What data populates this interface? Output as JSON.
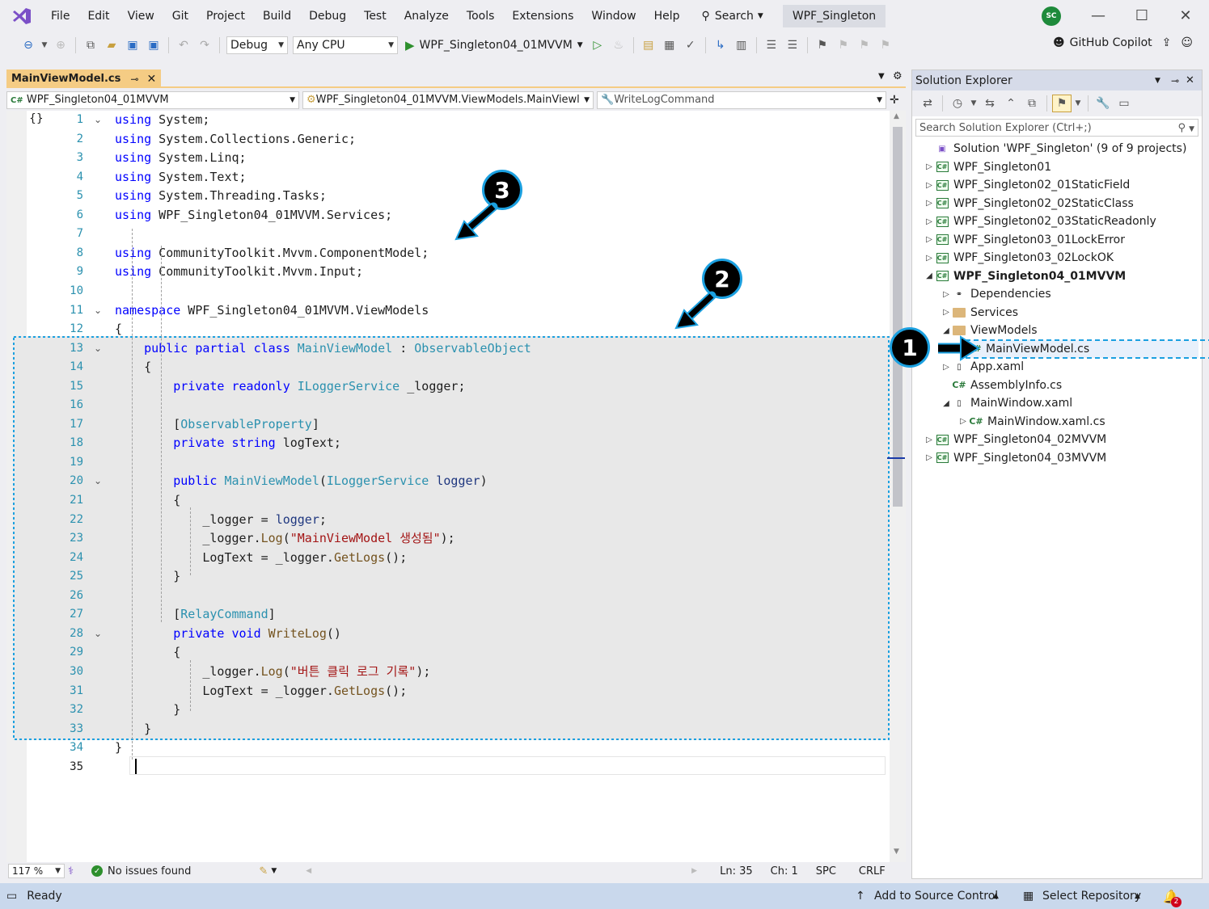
{
  "menu": [
    "File",
    "Edit",
    "View",
    "Git",
    "Project",
    "Build",
    "Debug",
    "Test",
    "Analyze",
    "Tools",
    "Extensions",
    "Window",
    "Help"
  ],
  "search_label": "Search",
  "solution_title": "WPF_Singleton",
  "avatar_initials": "SC",
  "toolbar": {
    "config": "Debug",
    "platform": "Any CPU",
    "run_target": "WPF_Singleton04_01MVVM",
    "copilot": "GitHub Copilot"
  },
  "editor": {
    "tab": "MainViewModel.cs",
    "nav_project": "WPF_Singleton04_01MVVM",
    "nav_class": "WPF_Singleton04_01MVVM.ViewModels.MainViewl",
    "nav_member": "WriteLogCommand",
    "zoom": "117 %",
    "issues": "No issues found",
    "ln": "Ln: 35",
    "ch": "Ch: 1",
    "spc": "SPC",
    "crlf": "CRLF"
  },
  "code_lines": [
    "1",
    "2",
    "3",
    "4",
    "5",
    "6",
    "7",
    "8",
    "9",
    "10",
    "11",
    "12",
    "13",
    "14",
    "15",
    "16",
    "17",
    "18",
    "19",
    "20",
    "21",
    "22",
    "23",
    "24",
    "25",
    "26",
    "27",
    "28",
    "29",
    "30",
    "31",
    "32",
    "33",
    "34",
    "35"
  ],
  "code_text": {
    "l1": "System;",
    "l2": "System.Collections.Generic;",
    "l3": "System.Linq;",
    "l4": "System.Text;",
    "l5": "System.Threading.Tasks;",
    "l6": "WPF_Singleton04_01MVVM.Services;",
    "l8": "CommunityToolkit.Mvvm.ComponentModel;",
    "l9": "CommunityToolkit.Mvvm.Input;",
    "kw_using": "using",
    "kw_namespace": "namespace",
    "ns": "WPF_Singleton04_01MVVM.ViewModels",
    "l13_kw": "public partial class",
    "l13_cls": "MainViewModel",
    "l13_base": "ObservableObject",
    "l15_kw": "private readonly",
    "l15_ty": "ILoggerService",
    "l15_f": "_logger;",
    "l17_attr": "ObservableProperty",
    "l18_kw": "private string",
    "l18_f": "logText;",
    "l20_kw": "public",
    "l20_m": "MainViewModel",
    "l20_ty": "ILoggerService",
    "l20_p": "logger",
    "l22_a": "_logger = ",
    "l22_p": "logger",
    "l23_a": "_logger.",
    "l23_m": "Log",
    "l23_s": "\"MainViewModel 생성됨\"",
    "l24_a": "LogText = _logger.",
    "l24_m": "GetLogs",
    "l27_attr": "RelayCommand",
    "l28_kw": "private void",
    "l28_m": "WriteLog",
    "l30_s": "\"버튼 클릭 로그 기록\""
  },
  "solution_explorer": {
    "title": "Solution Explorer",
    "search_placeholder": "Search Solution Explorer (Ctrl+;)",
    "root": "Solution 'WPF_Singleton' (9 of 9 projects)",
    "items": [
      "WPF_Singleton01",
      "WPF_Singleton02_01StaticField",
      "WPF_Singleton02_02StaticClass",
      "WPF_Singleton02_03StaticReadonly",
      "WPF_Singleton03_01LockError",
      "WPF_Singleton03_02LockOK",
      "WPF_Singleton04_01MVVM",
      "Dependencies",
      "Services",
      "ViewModels",
      "MainViewModel.cs",
      "App.xaml",
      "AssemblyInfo.cs",
      "MainWindow.xaml",
      "MainWindow.xaml.cs",
      "WPF_Singleton04_02MVVM",
      "WPF_Singleton04_03MVVM"
    ]
  },
  "statusbar": {
    "ready": "Ready",
    "source_control": "Add to Source Control",
    "repo": "Select Repository",
    "notifications": "2"
  },
  "callouts": [
    "1",
    "2",
    "3"
  ],
  "colors": {
    "accent": "#1ba0e0",
    "tab": "#f5cc84",
    "statusbar": "#c9d8ec"
  }
}
